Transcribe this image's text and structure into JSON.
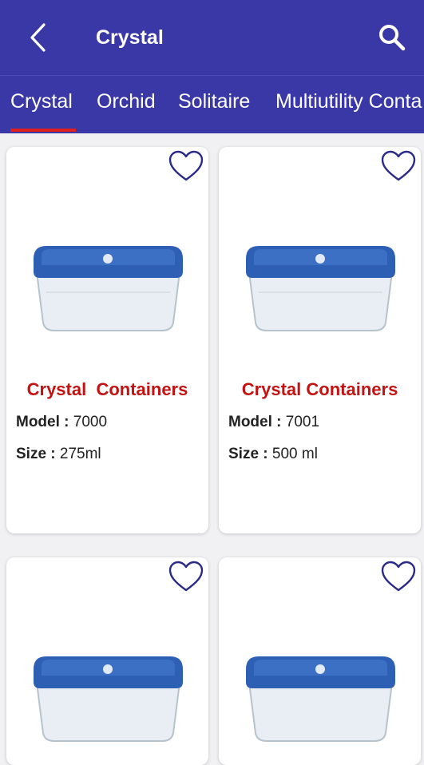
{
  "header": {
    "title": "Crystal",
    "back_icon": "chevron-left-icon",
    "search_icon": "search-icon"
  },
  "tabs": [
    {
      "label": "Crystal",
      "selected": true
    },
    {
      "label": "Orchid",
      "selected": false
    },
    {
      "label": "Solitaire",
      "selected": false
    },
    {
      "label": "Multiutility Conta",
      "selected": false
    }
  ],
  "labels": {
    "model": "Model :",
    "size": "Size :"
  },
  "products": [
    {
      "name": "Crystal  Containers",
      "model": "7000",
      "size": "275ml"
    },
    {
      "name": "Crystal Containers",
      "model": "7001",
      "size": "500 ml"
    },
    {
      "name": "",
      "model": "",
      "size": ""
    },
    {
      "name": "",
      "model": "",
      "size": ""
    }
  ],
  "colors": {
    "appbar": "#3a37a6",
    "tab_indicator": "#e0201c",
    "product_name": "#c41212",
    "heart_outline": "#2b2a86",
    "container_lid": "#2d5fb5"
  }
}
